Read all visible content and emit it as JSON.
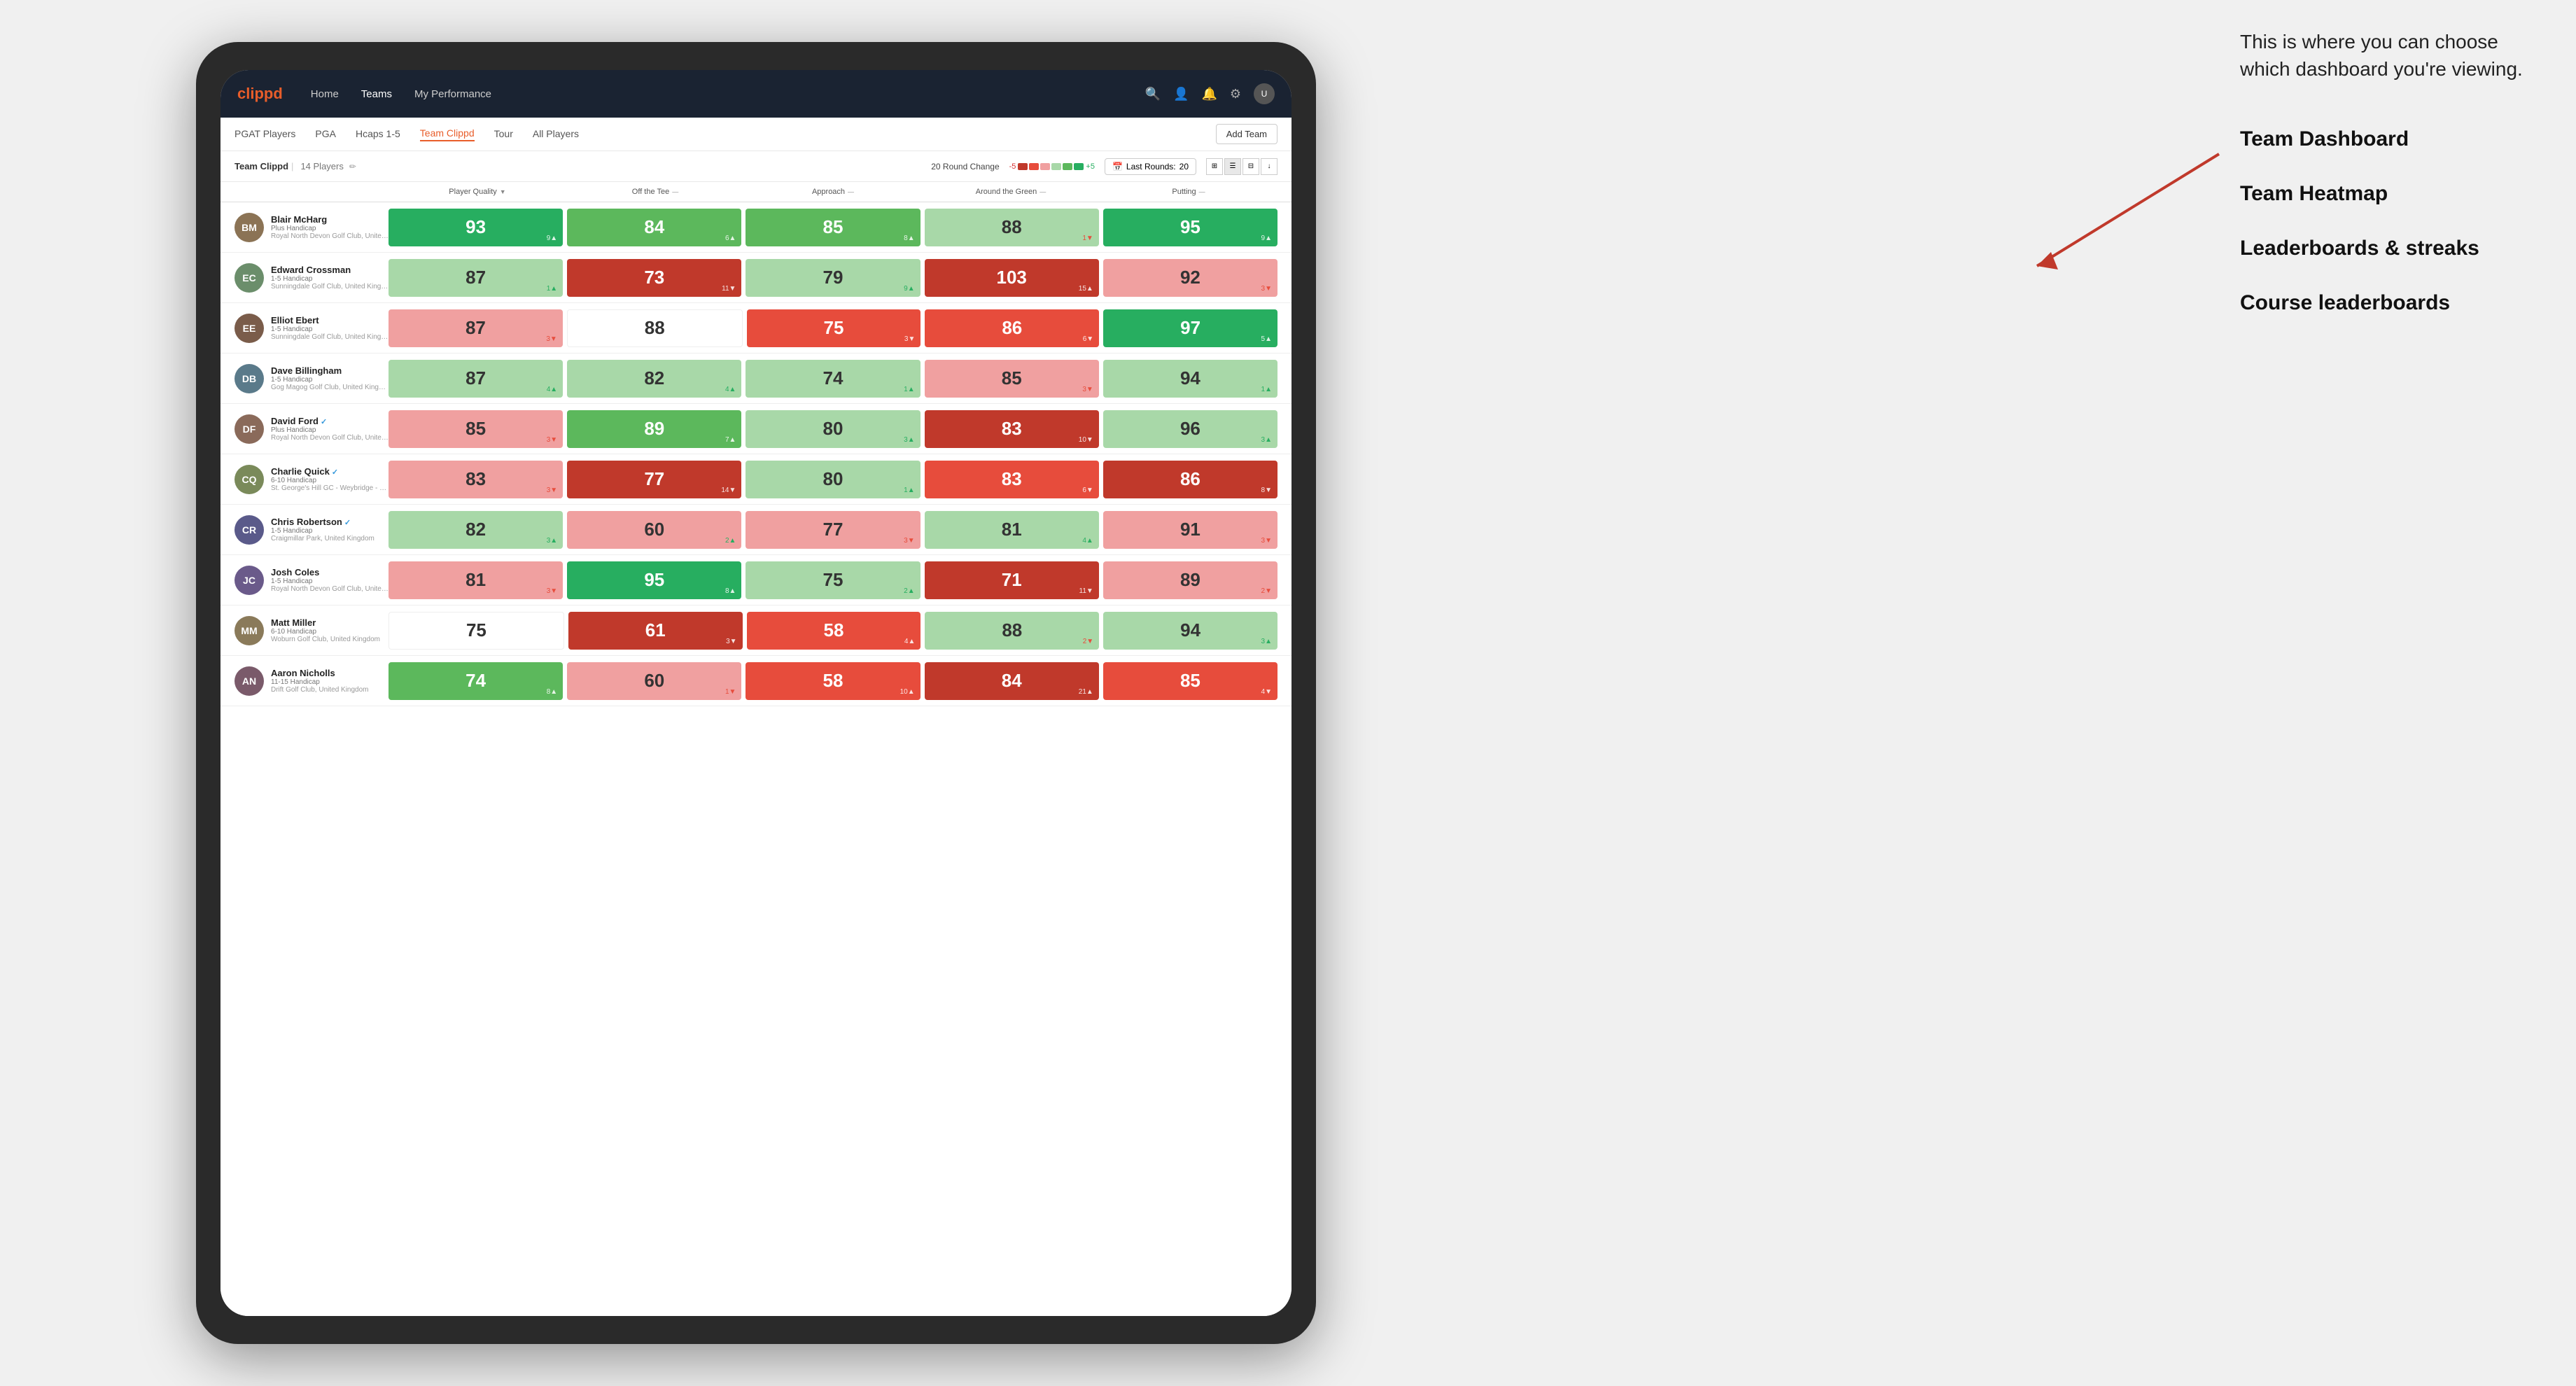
{
  "annotation": {
    "intro_text": "This is where you can choose which dashboard you're viewing.",
    "options": [
      {
        "label": "Team Dashboard"
      },
      {
        "label": "Team Heatmap"
      },
      {
        "label": "Leaderboards & streaks"
      },
      {
        "label": "Course leaderboards"
      }
    ]
  },
  "navbar": {
    "logo": "clippd",
    "links": [
      {
        "label": "Home",
        "active": false
      },
      {
        "label": "Teams",
        "active": false
      },
      {
        "label": "My Performance",
        "active": false
      }
    ]
  },
  "subnav": {
    "links": [
      {
        "label": "PGAT Players",
        "active": false
      },
      {
        "label": "PGA",
        "active": false
      },
      {
        "label": "Hcaps 1-5",
        "active": false
      },
      {
        "label": "Team Clippd",
        "active": true
      },
      {
        "label": "Tour",
        "active": false
      },
      {
        "label": "All Players",
        "active": false
      }
    ],
    "add_team": "Add Team"
  },
  "team_header": {
    "name": "Team Clippd",
    "separator": "|",
    "count": "14 Players",
    "round_change_label": "20 Round Change",
    "scale_neg": "-5",
    "scale_pos": "+5",
    "last_rounds_label": "Last Rounds:",
    "last_rounds_value": "20"
  },
  "columns": {
    "player_quality": "Player Quality",
    "off_tee": "Off the Tee",
    "approach": "Approach",
    "around_green": "Around the Green",
    "putting": "Putting"
  },
  "players": [
    {
      "name": "Blair McHarg",
      "handicap": "Plus Handicap",
      "club": "Royal North Devon Golf Club, United Kingdom",
      "avatar_initials": "BM",
      "avatar_color": "#8B7355",
      "scores": [
        {
          "value": "93",
          "change": "9▲",
          "bg": "green-dark",
          "colored": true
        },
        {
          "value": "84",
          "change": "6▲",
          "bg": "green-mid",
          "colored": true
        },
        {
          "value": "85",
          "change": "8▲",
          "bg": "green-mid",
          "colored": true
        },
        {
          "value": "88",
          "change": "1▼",
          "bg": "green-light",
          "colored": false
        },
        {
          "value": "95",
          "change": "9▲",
          "bg": "green-dark",
          "colored": true
        }
      ]
    },
    {
      "name": "Edward Crossman",
      "handicap": "1-5 Handicap",
      "club": "Sunningdale Golf Club, United Kingdom",
      "avatar_initials": "EC",
      "avatar_color": "#6b8e6b",
      "scores": [
        {
          "value": "87",
          "change": "1▲",
          "bg": "green-light",
          "colored": false
        },
        {
          "value": "73",
          "change": "11▼",
          "bg": "red-dark",
          "colored": true
        },
        {
          "value": "79",
          "change": "9▲",
          "bg": "green-light",
          "colored": false
        },
        {
          "value": "103",
          "change": "15▲",
          "bg": "red-dark",
          "colored": true
        },
        {
          "value": "92",
          "change": "3▼",
          "bg": "red-light",
          "colored": false
        }
      ]
    },
    {
      "name": "Elliot Ebert",
      "handicap": "1-5 Handicap",
      "club": "Sunningdale Golf Club, United Kingdom",
      "avatar_initials": "EE",
      "avatar_color": "#7a5c4a",
      "scores": [
        {
          "value": "87",
          "change": "3▼",
          "bg": "red-light",
          "colored": false
        },
        {
          "value": "88",
          "change": "",
          "bg": "white",
          "colored": false
        },
        {
          "value": "75",
          "change": "3▼",
          "bg": "red-mid",
          "colored": true
        },
        {
          "value": "86",
          "change": "6▼",
          "bg": "red-mid",
          "colored": true
        },
        {
          "value": "97",
          "change": "5▲",
          "bg": "green-dark",
          "colored": true
        }
      ]
    },
    {
      "name": "Dave Billingham",
      "handicap": "1-5 Handicap",
      "club": "Gog Magog Golf Club, United Kingdom",
      "avatar_initials": "DB",
      "avatar_color": "#5a7a8a",
      "scores": [
        {
          "value": "87",
          "change": "4▲",
          "bg": "green-light",
          "colored": false
        },
        {
          "value": "82",
          "change": "4▲",
          "bg": "green-light",
          "colored": false
        },
        {
          "value": "74",
          "change": "1▲",
          "bg": "green-light",
          "colored": false
        },
        {
          "value": "85",
          "change": "3▼",
          "bg": "red-light",
          "colored": false
        },
        {
          "value": "94",
          "change": "1▲",
          "bg": "green-light",
          "colored": false
        }
      ]
    },
    {
      "name": "David Ford",
      "handicap": "Plus Handicap",
      "club": "Royal North Devon Golf Club, United Kingdom",
      "avatar_initials": "DF",
      "avatar_color": "#8a6a5a",
      "verified": true,
      "scores": [
        {
          "value": "85",
          "change": "3▼",
          "bg": "red-light",
          "colored": false
        },
        {
          "value": "89",
          "change": "7▲",
          "bg": "green-mid",
          "colored": true
        },
        {
          "value": "80",
          "change": "3▲",
          "bg": "green-light",
          "colored": false
        },
        {
          "value": "83",
          "change": "10▼",
          "bg": "red-dark",
          "colored": true
        },
        {
          "value": "96",
          "change": "3▲",
          "bg": "green-light",
          "colored": false
        }
      ]
    },
    {
      "name": "Charlie Quick",
      "handicap": "6-10 Handicap",
      "club": "St. George's Hill GC - Weybridge - Surrey, Uni...",
      "avatar_initials": "CQ",
      "avatar_color": "#7a8a5a",
      "verified": true,
      "scores": [
        {
          "value": "83",
          "change": "3▼",
          "bg": "red-light",
          "colored": false
        },
        {
          "value": "77",
          "change": "14▼",
          "bg": "red-dark",
          "colored": true
        },
        {
          "value": "80",
          "change": "1▲",
          "bg": "green-light",
          "colored": false
        },
        {
          "value": "83",
          "change": "6▼",
          "bg": "red-mid",
          "colored": true
        },
        {
          "value": "86",
          "change": "8▼",
          "bg": "red-dark",
          "colored": true
        }
      ]
    },
    {
      "name": "Chris Robertson",
      "handicap": "1-5 Handicap",
      "club": "Craigmillar Park, United Kingdom",
      "avatar_initials": "CR",
      "avatar_color": "#5a5a8a",
      "verified": true,
      "scores": [
        {
          "value": "82",
          "change": "3▲",
          "bg": "green-light",
          "colored": false
        },
        {
          "value": "60",
          "change": "2▲",
          "bg": "red-light",
          "colored": false
        },
        {
          "value": "77",
          "change": "3▼",
          "bg": "red-light",
          "colored": false
        },
        {
          "value": "81",
          "change": "4▲",
          "bg": "green-light",
          "colored": false
        },
        {
          "value": "91",
          "change": "3▼",
          "bg": "red-light",
          "colored": false
        }
      ]
    },
    {
      "name": "Josh Coles",
      "handicap": "1-5 Handicap",
      "club": "Royal North Devon Golf Club, United Kingdom",
      "avatar_initials": "JC",
      "avatar_color": "#6a5a8a",
      "scores": [
        {
          "value": "81",
          "change": "3▼",
          "bg": "red-light",
          "colored": false
        },
        {
          "value": "95",
          "change": "8▲",
          "bg": "green-dark",
          "colored": true
        },
        {
          "value": "75",
          "change": "2▲",
          "bg": "green-light",
          "colored": false
        },
        {
          "value": "71",
          "change": "11▼",
          "bg": "red-dark",
          "colored": true
        },
        {
          "value": "89",
          "change": "2▼",
          "bg": "red-light",
          "colored": false
        }
      ]
    },
    {
      "name": "Matt Miller",
      "handicap": "6-10 Handicap",
      "club": "Woburn Golf Club, United Kingdom",
      "avatar_initials": "MM",
      "avatar_color": "#8a7a5a",
      "scores": [
        {
          "value": "75",
          "change": "",
          "bg": "white",
          "colored": false
        },
        {
          "value": "61",
          "change": "3▼",
          "bg": "red-dark",
          "colored": true
        },
        {
          "value": "58",
          "change": "4▲",
          "bg": "red-mid",
          "colored": true
        },
        {
          "value": "88",
          "change": "2▼",
          "bg": "green-light",
          "colored": false
        },
        {
          "value": "94",
          "change": "3▲",
          "bg": "green-light",
          "colored": false
        }
      ]
    },
    {
      "name": "Aaron Nicholls",
      "handicap": "11-15 Handicap",
      "club": "Drift Golf Club, United Kingdom",
      "avatar_initials": "AN",
      "avatar_color": "#7a5a6a",
      "scores": [
        {
          "value": "74",
          "change": "8▲",
          "bg": "green-mid",
          "colored": true
        },
        {
          "value": "60",
          "change": "1▼",
          "bg": "red-light",
          "colored": false
        },
        {
          "value": "58",
          "change": "10▲",
          "bg": "red-mid",
          "colored": true
        },
        {
          "value": "84",
          "change": "21▲",
          "bg": "red-dark",
          "colored": true
        },
        {
          "value": "85",
          "change": "4▼",
          "bg": "red-mid",
          "colored": true
        }
      ]
    }
  ]
}
